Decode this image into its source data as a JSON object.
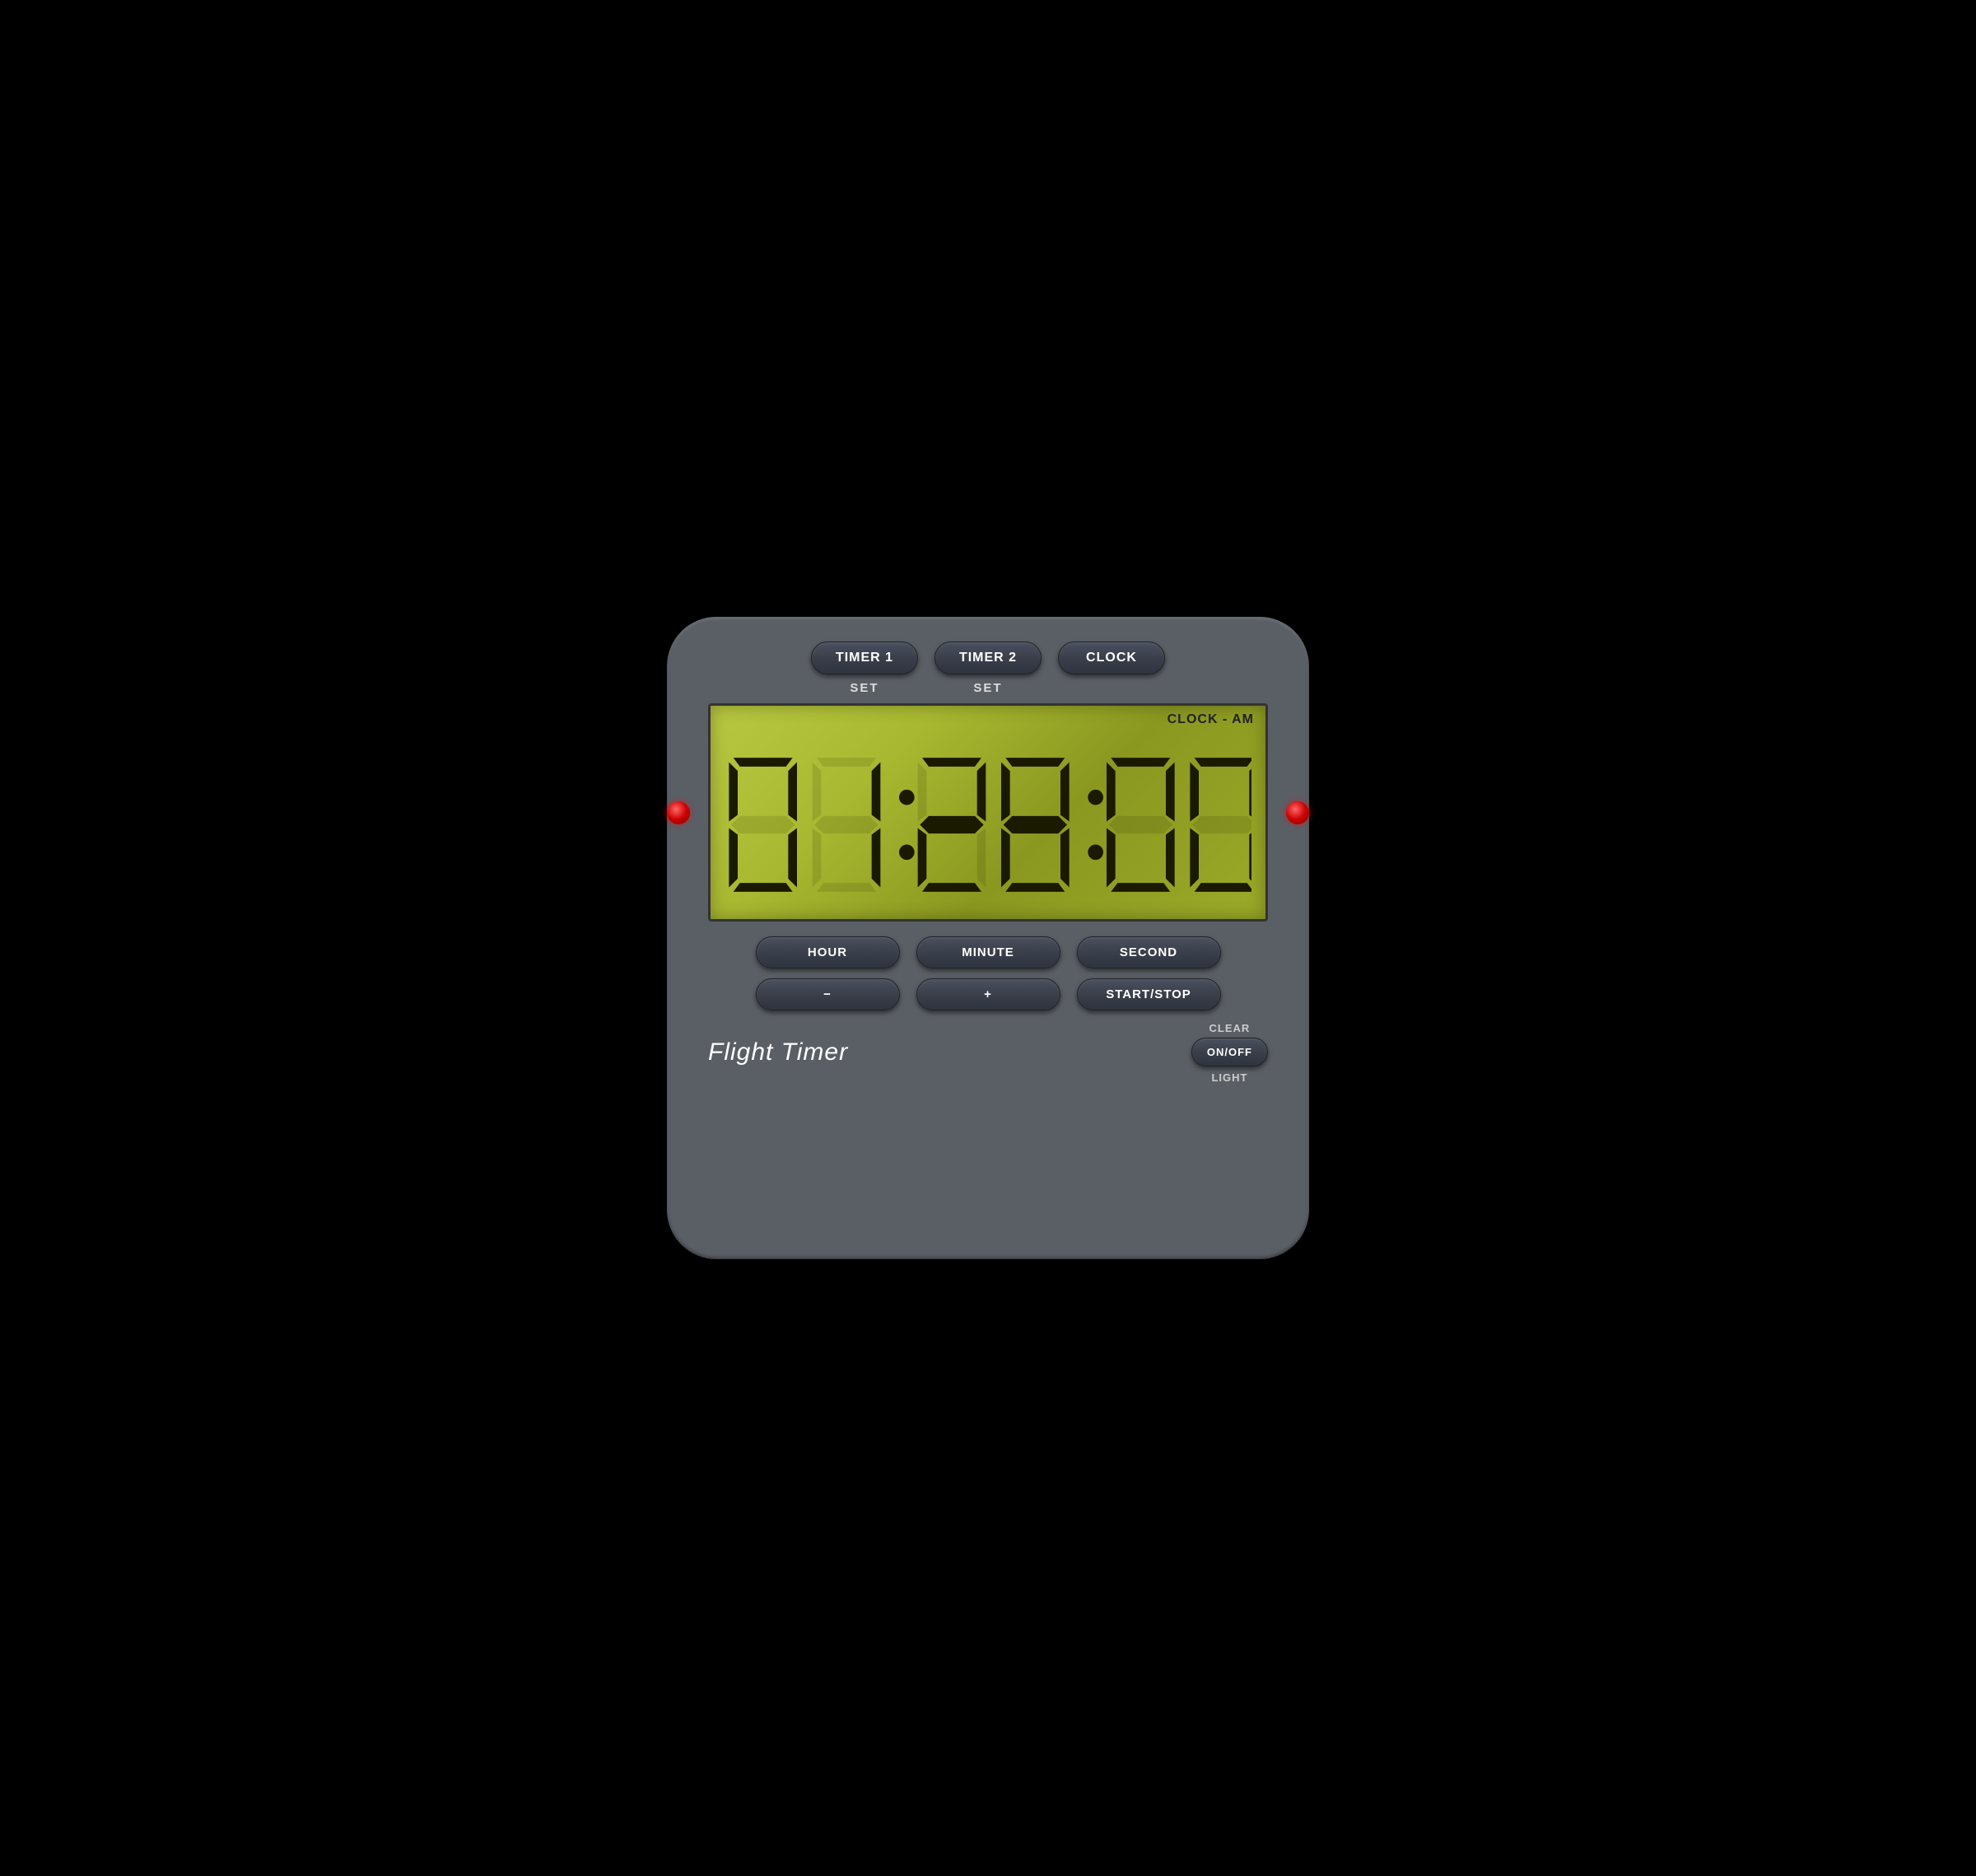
{
  "device": {
    "title": "Flight Timer",
    "brand": "Flight Timer"
  },
  "top_buttons": [
    {
      "id": "timer1",
      "label": "TIMER 1"
    },
    {
      "id": "timer2",
      "label": "TIMER 2"
    },
    {
      "id": "clock",
      "label": "CLOCK"
    }
  ],
  "set_labels": [
    {
      "id": "set1",
      "label": "SET"
    },
    {
      "id": "set2",
      "label": "SET"
    },
    {
      "id": "set3",
      "label": ""
    }
  ],
  "display": {
    "mode": "CLOCK - AM",
    "time": "01:28:00",
    "hours": "01",
    "minutes": "28",
    "seconds": "00"
  },
  "bottom_buttons": {
    "row1": [
      {
        "id": "hour",
        "label": "HOUR"
      },
      {
        "id": "minute",
        "label": "MINUTE"
      },
      {
        "id": "second",
        "label": "SECOND"
      }
    ],
    "row2": [
      {
        "id": "minus",
        "label": "−"
      },
      {
        "id": "plus",
        "label": "+"
      },
      {
        "id": "startstop",
        "label": "START/STOP"
      }
    ]
  },
  "labels": {
    "clear": "CLEAR",
    "onoff": "ON/OFF",
    "light": "LIGHT"
  }
}
